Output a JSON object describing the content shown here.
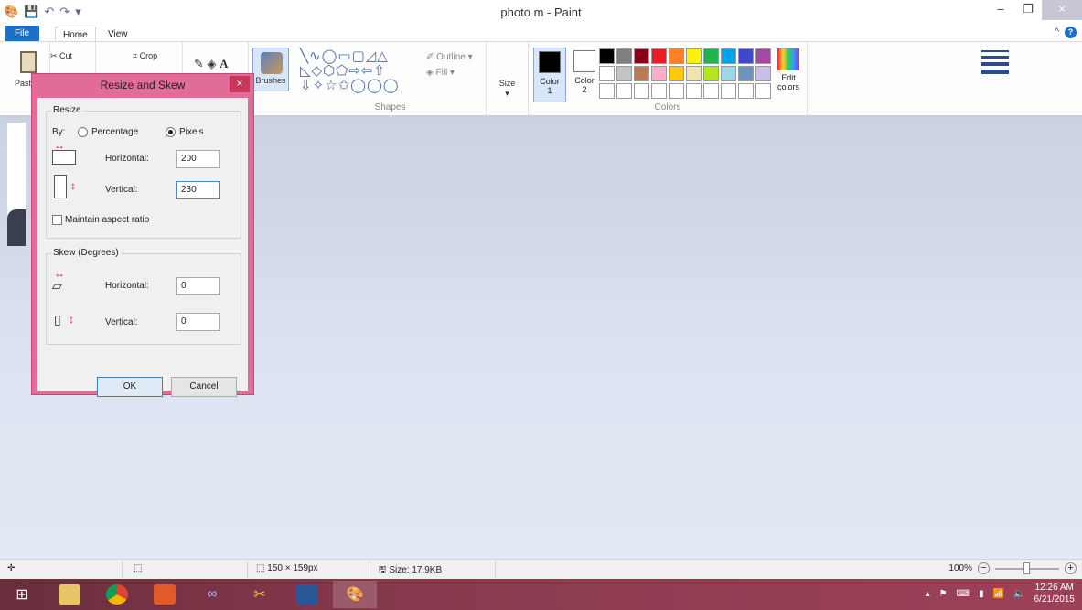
{
  "window": {
    "title": "photo m - Paint",
    "minimize_icon": "–",
    "restore_icon": "❐",
    "close_icon": "×"
  },
  "ribbon": {
    "tabs": {
      "file": "File",
      "home": "Home",
      "view": "View"
    },
    "clipboard": {
      "paste": "Paste",
      "cut": "Cut"
    },
    "image": {
      "crop": "Crop"
    },
    "brushes": "Brushes",
    "shapes": {
      "label": "Shapes",
      "outline": "Outline",
      "fill": "Fill"
    },
    "size": "Size",
    "colors": {
      "label": "Colors",
      "color1": "Color",
      "color1_num": "1",
      "color2": "Color",
      "color2_num": "2",
      "edit": "Edit colors",
      "color1_value": "#000000",
      "color2_value": "#ffffff",
      "palette": [
        "#000000",
        "#7f7f7f",
        "#880015",
        "#ed1c24",
        "#ff7f27",
        "#fff200",
        "#22b14c",
        "#00a2e8",
        "#3f48cc",
        "#a349a4",
        "#ffffff",
        "#c3c3c3",
        "#b97a57",
        "#ffaec9",
        "#ffc90e",
        "#efe4b0",
        "#b5e61d",
        "#99d9ea",
        "#7092be",
        "#c8bfe7",
        "#ffffff",
        "#ffffff",
        "#ffffff",
        "#ffffff",
        "#ffffff",
        "#ffffff",
        "#ffffff",
        "#ffffff",
        "#ffffff",
        "#ffffff"
      ]
    }
  },
  "dialog": {
    "title": "Resize and Skew",
    "resize": {
      "legend": "Resize",
      "by_label": "By:",
      "percentage": "Percentage",
      "pixels": "Pixels",
      "selected": "pixels",
      "horizontal_label": "Horizontal:",
      "horizontal_value": "200",
      "vertical_label": "Vertical:",
      "vertical_value": "230",
      "maintain_aspect": "Maintain aspect ratio",
      "maintain_checked": false
    },
    "skew": {
      "legend": "Skew (Degrees)",
      "horizontal_label": "Horizontal:",
      "horizontal_value": "0",
      "vertical_label": "Vertical:",
      "vertical_value": "0"
    },
    "ok": "OK",
    "cancel": "Cancel"
  },
  "status": {
    "dimensions": "150 × 159px",
    "size": "Size: 17.9KB",
    "zoom": "100%",
    "zoom_level": 0.5
  },
  "taskbar": {
    "time": "12:26 AM",
    "date": "6/21/2015"
  }
}
